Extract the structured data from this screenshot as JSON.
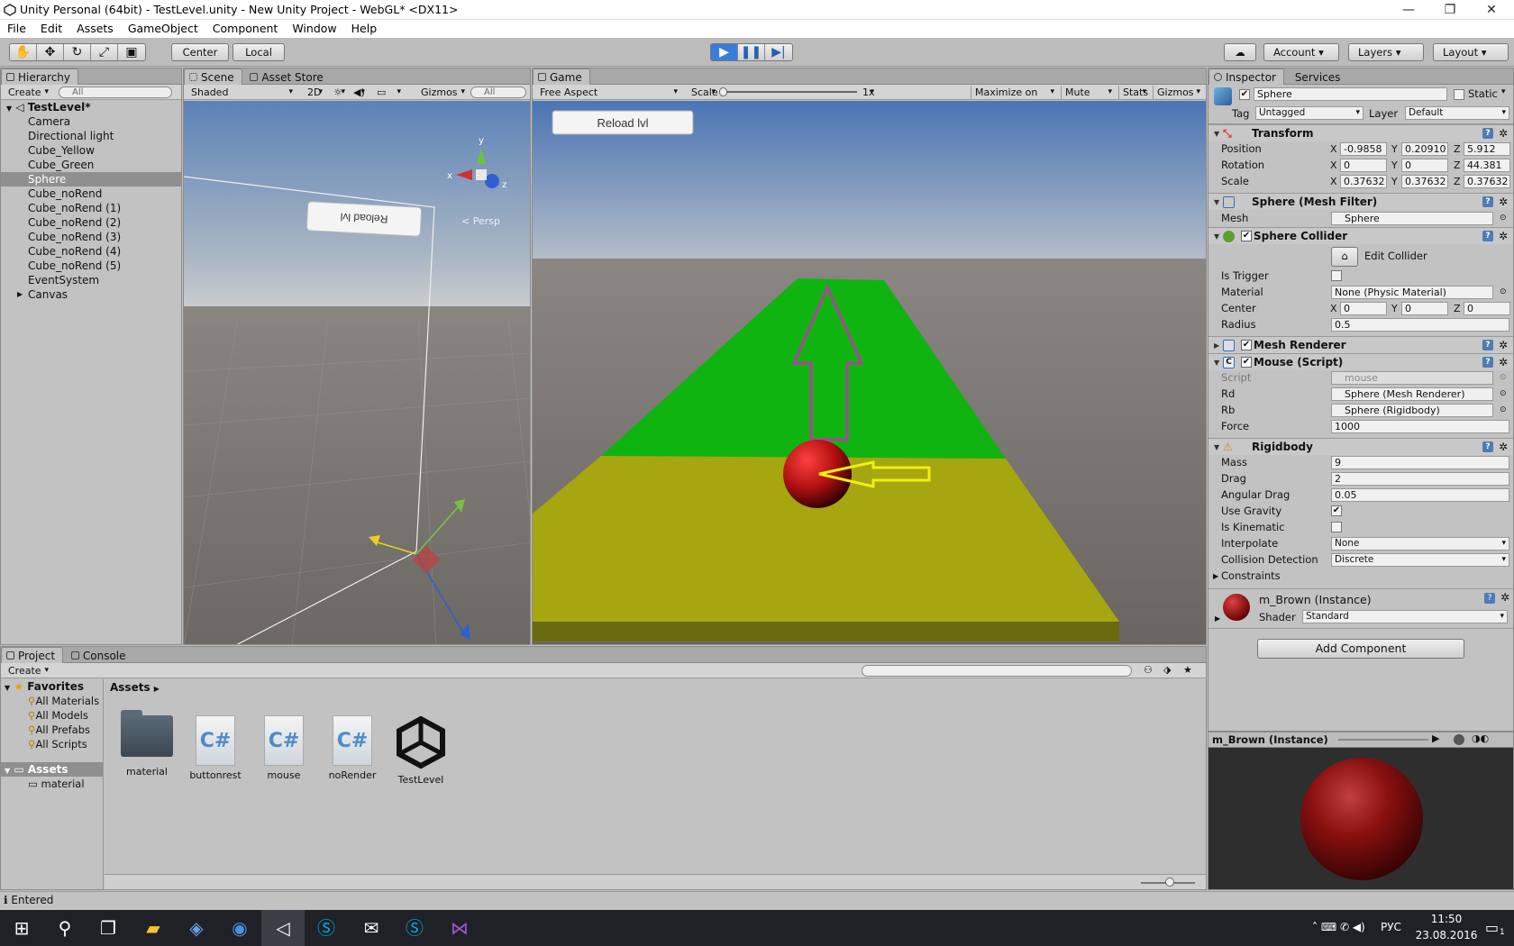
{
  "window": {
    "title": "Unity Personal (64bit) - TestLevel.unity - New Unity Project - WebGL* <DX11>",
    "minimize": "—",
    "maximize": "❐",
    "close": "✕"
  },
  "menu": [
    "File",
    "Edit",
    "Assets",
    "GameObject",
    "Component",
    "Window",
    "Help"
  ],
  "toolbar": {
    "pivot": "Center",
    "space": "Local",
    "account": "Account",
    "layers": "Layers",
    "layout": "Layout"
  },
  "hierarchy": {
    "tab": "Hierarchy",
    "create": "Create",
    "search_placeholder": "All",
    "scene": "TestLevel*",
    "items": [
      "Camera",
      "Directional light",
      "Cube_Yellow",
      "Cube_Green",
      "Sphere",
      "Cube_noRend",
      "Cube_noRend (1)",
      "Cube_noRend (2)",
      "Cube_noRend (3)",
      "Cube_noRend (4)",
      "Cube_noRend (5)",
      "EventSystem",
      "Canvas"
    ]
  },
  "scene_view": {
    "tab_scene": "Scene",
    "tab_store": "Asset Store",
    "shading": "Shaded",
    "mode2d": "2D",
    "gizmos": "Gizmos",
    "search_placeholder": "All",
    "persp": "< Persp",
    "mirrored_button": "Reload lvl",
    "axis_x": "x",
    "axis_y": "y",
    "axis_z": "z"
  },
  "game_view": {
    "tab": "Game",
    "aspect": "Free Aspect",
    "scale_label": "Scale",
    "scale_value": "1x",
    "maximize": "Maximize on Play",
    "mute": "Mute audio",
    "stats": "Stats",
    "gizmos": "Gizmos",
    "reload_button": "Reload lvl"
  },
  "inspector": {
    "tab": "Inspector",
    "services": "Services",
    "object_name": "Sphere",
    "static": "Static",
    "tag_label": "Tag",
    "tag": "Untagged",
    "layer_label": "Layer",
    "layer": "Default",
    "transform": {
      "title": "Transform",
      "position_label": "Position",
      "pos": [
        "-0.9858",
        "0.20910",
        "5.912"
      ],
      "rotation_label": "Rotation",
      "rot": [
        "0",
        "0",
        "44.381"
      ],
      "scale_label": "Scale",
      "scale": [
        "0.37632",
        "0.37632",
        "0.37632"
      ]
    },
    "mesh_filter": {
      "title": "Sphere (Mesh Filter)",
      "mesh_label": "Mesh",
      "mesh": "Sphere"
    },
    "collider": {
      "title": "Sphere Collider",
      "edit": "Edit Collider",
      "trigger_label": "Is Trigger",
      "material_label": "Material",
      "material": "None (Physic Material)",
      "center_label": "Center",
      "center": [
        "0",
        "0",
        "0"
      ],
      "radius_label": "Radius",
      "radius": "0.5"
    },
    "mesh_renderer": {
      "title": "Mesh Renderer"
    },
    "mouse_script": {
      "title": "Mouse (Script)",
      "script_label": "Script",
      "script": "mouse",
      "rd_label": "Rd",
      "rd": "Sphere (Mesh Renderer)",
      "rb_label": "Rb",
      "rb": "Sphere (Rigidbody)",
      "force_label": "Force",
      "force": "1000"
    },
    "rigidbody": {
      "title": "Rigidbody",
      "mass_label": "Mass",
      "mass": "9",
      "drag_label": "Drag",
      "drag": "2",
      "ang_label": "Angular Drag",
      "ang": "0.05",
      "gravity_label": "Use Gravity",
      "kinematic_label": "Is Kinematic",
      "interp_label": "Interpolate",
      "interp": "None",
      "coll_label": "Collision Detection",
      "coll": "Discrete",
      "constraints": "Constraints"
    },
    "material": {
      "name": "m_Brown (Instance)",
      "shader_label": "Shader",
      "shader": "Standard"
    },
    "add_component": "Add Component",
    "preview_title": "m_Brown (Instance)"
  },
  "project": {
    "tab": "Project",
    "console": "Console",
    "create": "Create",
    "favorites": "Favorites",
    "fav_items": [
      "All Materials",
      "All Models",
      "All Prefabs",
      "All Scripts"
    ],
    "assets_root": "Assets",
    "assets_folder": "material",
    "breadcrumb": "Assets",
    "files": [
      {
        "name": "material",
        "kind": "folder"
      },
      {
        "name": "buttonrest",
        "kind": "cs"
      },
      {
        "name": "mouse",
        "kind": "cs"
      },
      {
        "name": "noRender",
        "kind": "cs"
      },
      {
        "name": "TestLevel",
        "kind": "unity"
      }
    ]
  },
  "status": "Entered",
  "taskbar": {
    "lang": "РУС",
    "time": "11:50",
    "date": "23.08.2016",
    "notify": "1"
  },
  "colors": {
    "play_active": "#3a7dd8",
    "green_road": "#10b411",
    "yellow_road": "#a5a610",
    "sphere": "#b31414",
    "arrow_up": "#b040a0",
    "arrow_left": "#f0f010"
  }
}
